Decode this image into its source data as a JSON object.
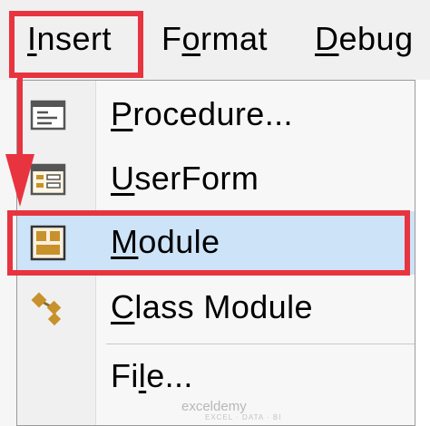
{
  "menubar": {
    "items": [
      {
        "label": "Insert",
        "mnemonic": "I"
      },
      {
        "label": "Format",
        "mnemonic": "o"
      },
      {
        "label": "Debug",
        "mnemonic": "D"
      }
    ]
  },
  "dropdown": {
    "items": [
      {
        "label": "Procedure...",
        "icon": "procedure-icon"
      },
      {
        "label": "UserForm",
        "icon": "userform-icon"
      },
      {
        "label": "Module",
        "icon": "module-icon",
        "selected": true
      },
      {
        "label": "Class Module",
        "icon": "class-module-icon"
      },
      {
        "label": "File...",
        "icon": null
      }
    ]
  },
  "annotations": {
    "highlight_color": "#e8343f",
    "selected_bg": "#cde3f7"
  },
  "watermark": {
    "brand": "exceldemy",
    "tagline": "EXCEL · DATA · BI"
  }
}
